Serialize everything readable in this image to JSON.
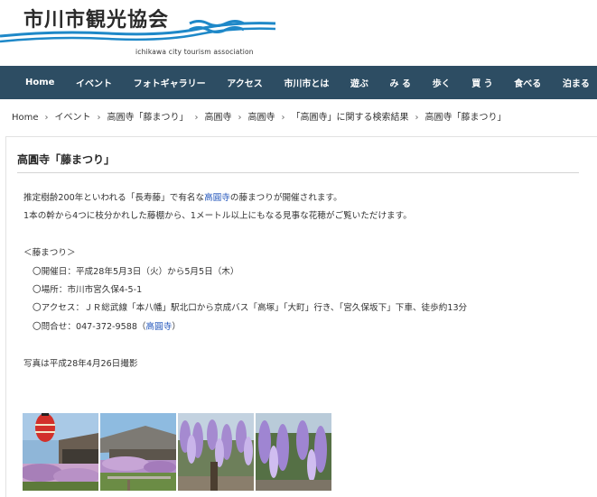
{
  "header": {
    "title": "市川市観光協会",
    "subtitle": "ichikawa city tourism association"
  },
  "colors": {
    "nav_bg": "#2d4d63",
    "link": "#2255bb",
    "logo_blue": "#1e88c8"
  },
  "nav": {
    "items": [
      {
        "label": "Home"
      },
      {
        "label": "イベント"
      },
      {
        "label": "フォトギャラリー"
      },
      {
        "label": "アクセス"
      },
      {
        "label": "市川市とは"
      },
      {
        "label": "遊ぶ"
      },
      {
        "label": "み る"
      },
      {
        "label": "歩く"
      },
      {
        "label": "買 う"
      },
      {
        "label": "食べる"
      },
      {
        "label": "泊まる"
      }
    ]
  },
  "breadcrumb": {
    "items": [
      {
        "label": "Home"
      },
      {
        "label": "イベント"
      },
      {
        "label": "高圓寺「藤まつり」"
      },
      {
        "label": "高圓寺"
      },
      {
        "label": "高圓寺"
      },
      {
        "label": "「高圓寺」に関する検索結果"
      },
      {
        "label": "高圓寺「藤まつり」"
      }
    ],
    "separator": "›"
  },
  "article": {
    "title": "高圓寺「藤まつり」",
    "intro_before": "推定樹齢200年といわれる「長寿藤」で有名な",
    "intro_link": "高圓寺",
    "intro_after": "の藤まつりが開催されます。",
    "intro_line2": "1本の幹から4つに枝分かれした藤棚から、1メートル以上にもなる見事な花穂がご覧いただけます。",
    "section_heading": "＜藤まつり＞",
    "date": "〇開催日：平成28年5月3日（火）から5月5日（木）",
    "place": "〇場所：市川市宮久保4-5-1",
    "access": "〇アクセス：ＪＲ総武線「本八幡」駅北口から京成バス「高塚」「大町」行き、「宮久保坂下」下車、徒歩約13分",
    "contact_before": "〇問合せ：047-372-9588（",
    "contact_link": "高圓寺",
    "contact_after": "）",
    "photo_note": "写真は平成28年4月26日撮影"
  },
  "photos": [
    {
      "name": "temple-lantern-photo"
    },
    {
      "name": "temple-wisteria-photo"
    },
    {
      "name": "wisteria-trellis-photo"
    },
    {
      "name": "wisteria-closeup-photo"
    }
  ]
}
